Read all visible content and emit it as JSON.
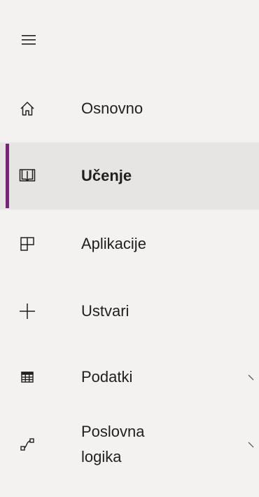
{
  "nav": {
    "menu_icon": "hamburger-menu-icon",
    "accent_color": "#742774",
    "selected_bg": "#e6e5e4",
    "items": [
      {
        "label": "Osnovno",
        "icon": "home-icon",
        "selected": false,
        "expandable": false
      },
      {
        "label": "Učenje",
        "icon": "book-icon",
        "selected": true,
        "expandable": false
      },
      {
        "label": "Aplikacije",
        "icon": "apps-grid-icon",
        "selected": false,
        "expandable": false
      },
      {
        "label": "Ustvari",
        "icon": "plus-icon",
        "selected": false,
        "expandable": false
      },
      {
        "label": "Podatki",
        "icon": "table-icon",
        "selected": false,
        "expandable": true
      },
      {
        "label": "Poslovna logika",
        "icon": "flow-icon",
        "selected": false,
        "expandable": true
      }
    ]
  }
}
